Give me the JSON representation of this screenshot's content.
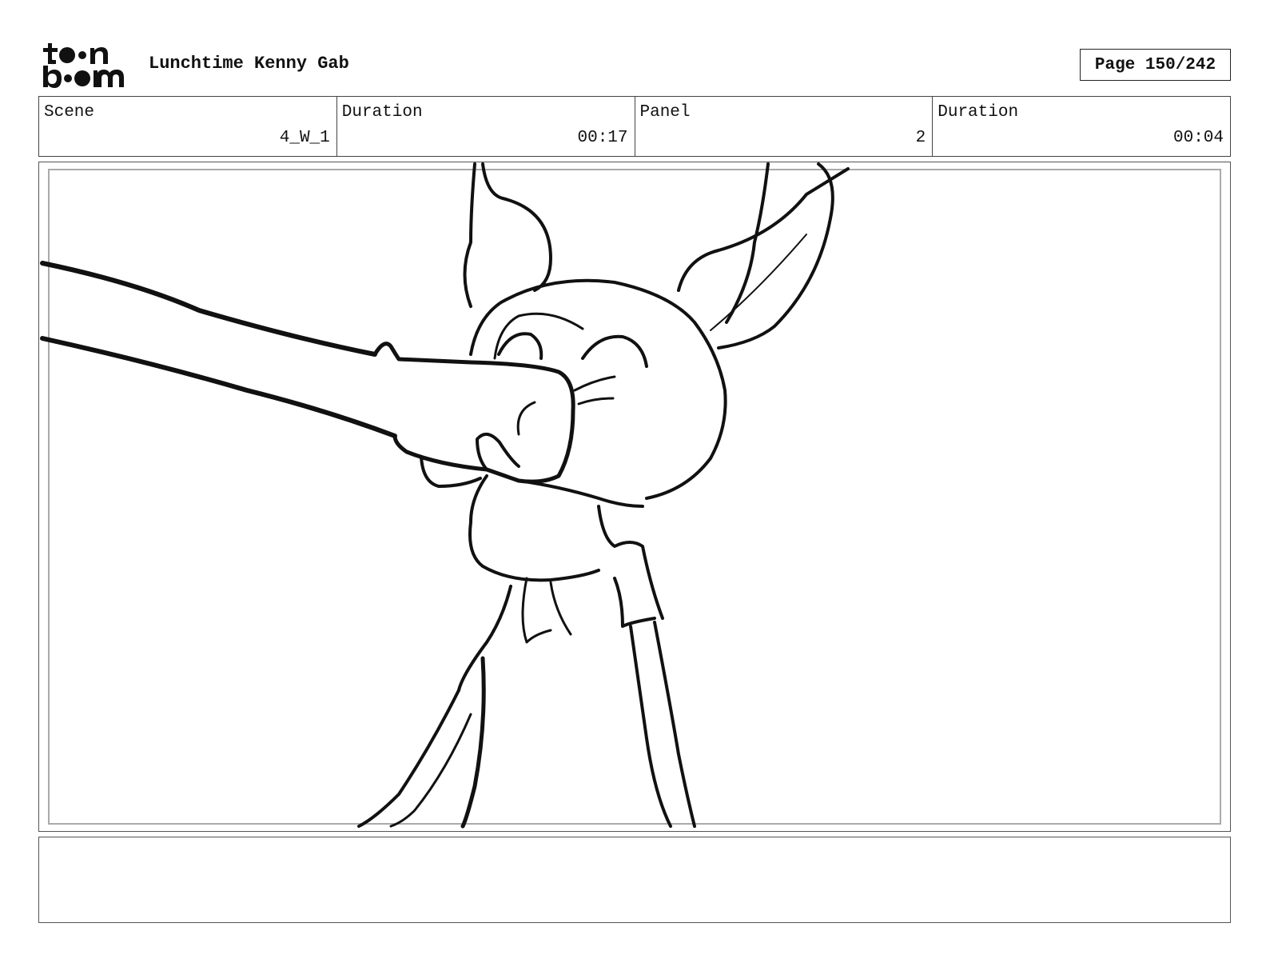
{
  "header": {
    "logo_top": "t••n",
    "logo_bottom": "b••m",
    "project_title": "Lunchtime Kenny Gab",
    "page_indicator": "Page 150/242"
  },
  "info_bar": {
    "scene_label": "Scene",
    "scene_value": "4_W_1",
    "scene_duration_label": "Duration",
    "scene_duration_value": "00:17",
    "panel_label": "Panel",
    "panel_value": "2",
    "panel_duration_label": "Duration",
    "panel_duration_value": "00:04"
  },
  "notes": {
    "text": ""
  }
}
